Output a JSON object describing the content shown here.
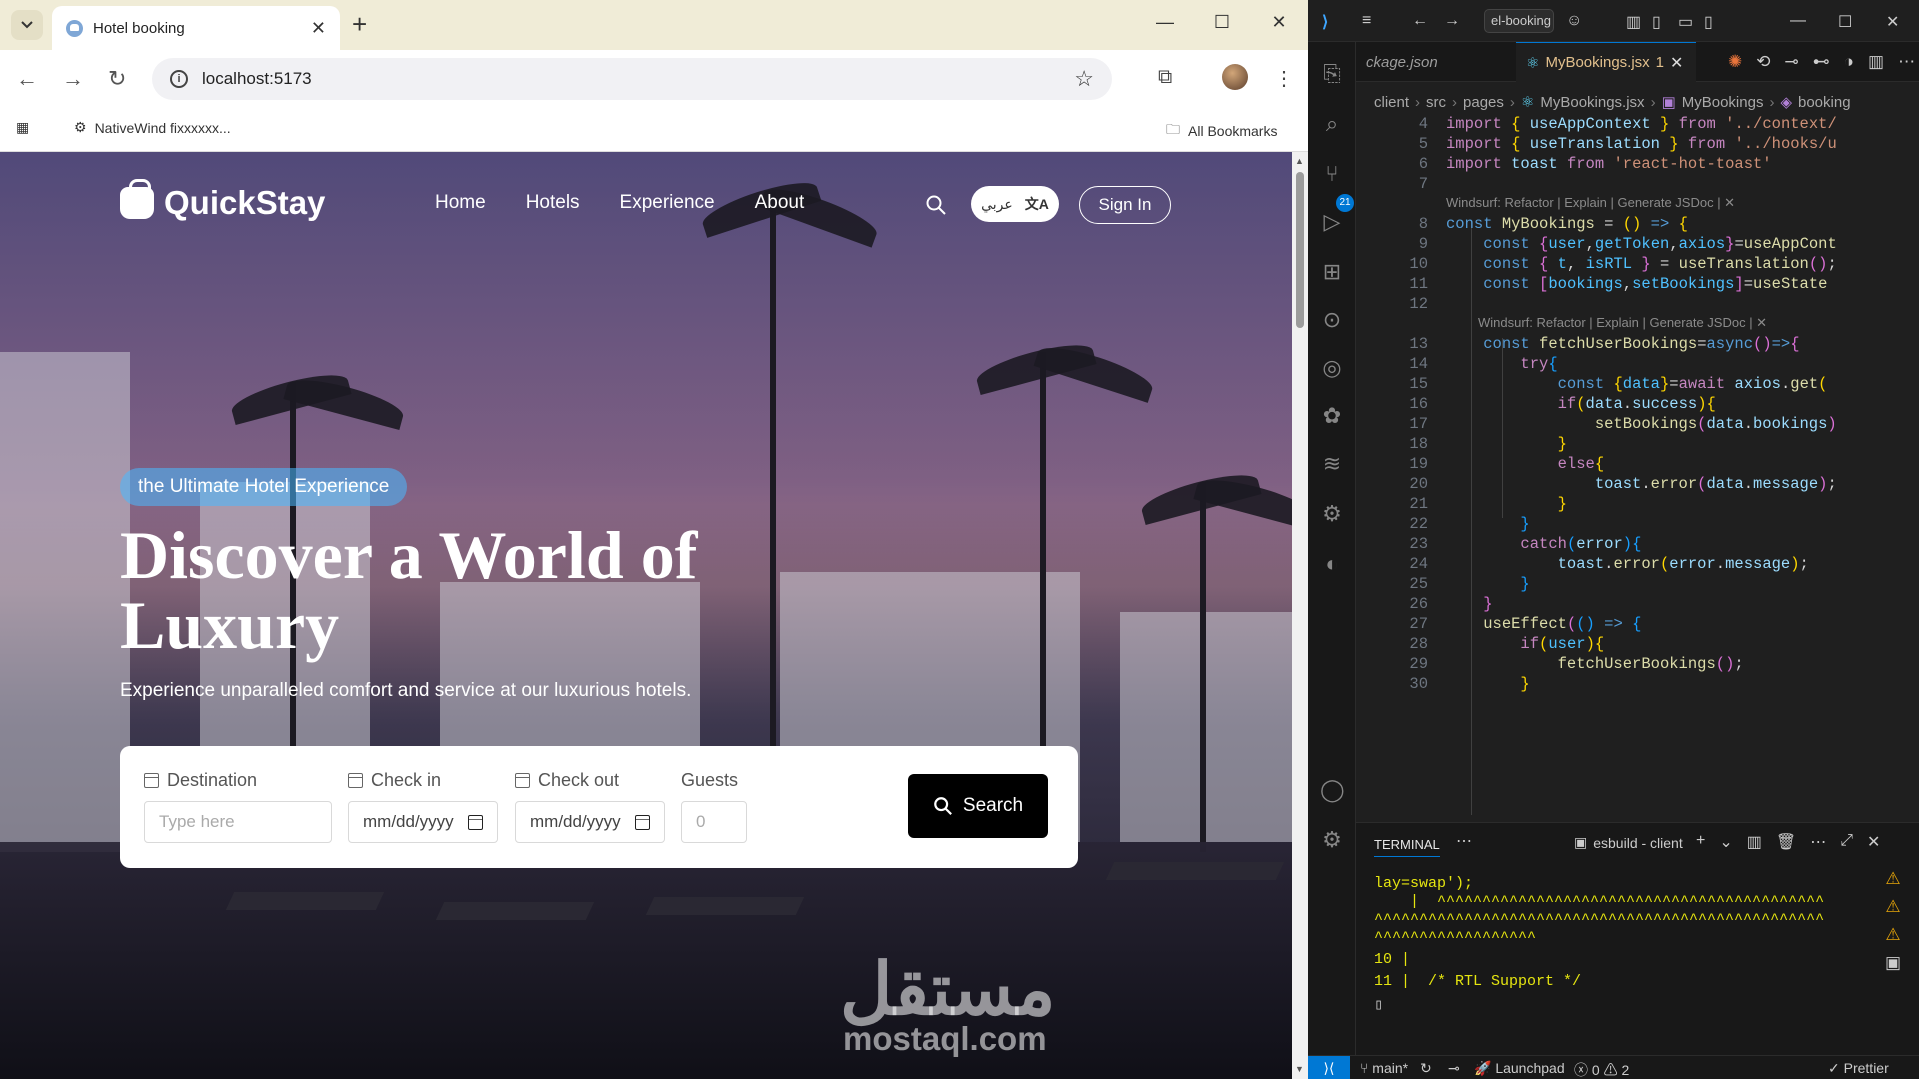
{
  "browser": {
    "tab_title": "Hotel booking",
    "url": "localhost:5173",
    "bookmark_1": "NativeWind fixxxxxx...",
    "bookmarks_all": "All Bookmarks"
  },
  "site": {
    "brand": "QuickStay",
    "nav": [
      "Home",
      "Hotels",
      "Experience",
      "About"
    ],
    "lang_label": "عربي",
    "signin": "Sign In",
    "pill": "the Ultimate Hotel Experience",
    "title_line1": "Discover a World of",
    "title_line2": "Luxury",
    "subtitle": "Experience unparalleled comfort and service at our luxurious hotels.",
    "form": {
      "destination_label": "Destination",
      "destination_placeholder": "Type here",
      "checkin_label": "Check in",
      "checkin_value": "mm/dd/yyyy",
      "checkout_label": "Check out",
      "checkout_value": "mm/dd/yyyy",
      "guests_label": "Guests",
      "guests_value": "0",
      "search_label": "Search"
    },
    "watermark_ar": "مستقل",
    "watermark_en": "mostaql.com"
  },
  "vscode": {
    "title_cmd": "el-booking",
    "tab_inactive": "ckage.json",
    "tab_active": "MyBookings.jsx",
    "tab_active_count": "1",
    "breadcrumbs": [
      "client",
      "src",
      "pages",
      "MyBookings.jsx",
      "MyBookings",
      "booking"
    ],
    "lens_1": "Windsurf: Refactor | Explain | Generate JSDoc | ✕",
    "lens_2": "Windsurf: Refactor | Explain | Generate JSDoc | ✕",
    "git_badge": "21",
    "terminal": {
      "tab": "TERMINAL",
      "task": "esbuild - client",
      "lines": [
        "lay=swap');",
        "    |  ^^^^^^^^^^^^^^^^^^^^^^^^^^^^^^^^^^^^^^^^^^^",
        "^^^^^^^^^^^^^^^^^^^^^^^^^^^^^^^^^^^^^^^^^^^^^^^^^^",
        "^^^^^^^^^^^^^^^^^^",
        "10 |",
        "11 |  /* RTL Support */",
        "▯"
      ]
    },
    "status": {
      "branch": "main*",
      "launchpad": "Launchpad",
      "errors": "0",
      "warnings": "2",
      "prettier": "Prettier"
    }
  },
  "colors": {
    "pill_bg": "#49b9ff",
    "vscode_accent": "#0078d4"
  }
}
